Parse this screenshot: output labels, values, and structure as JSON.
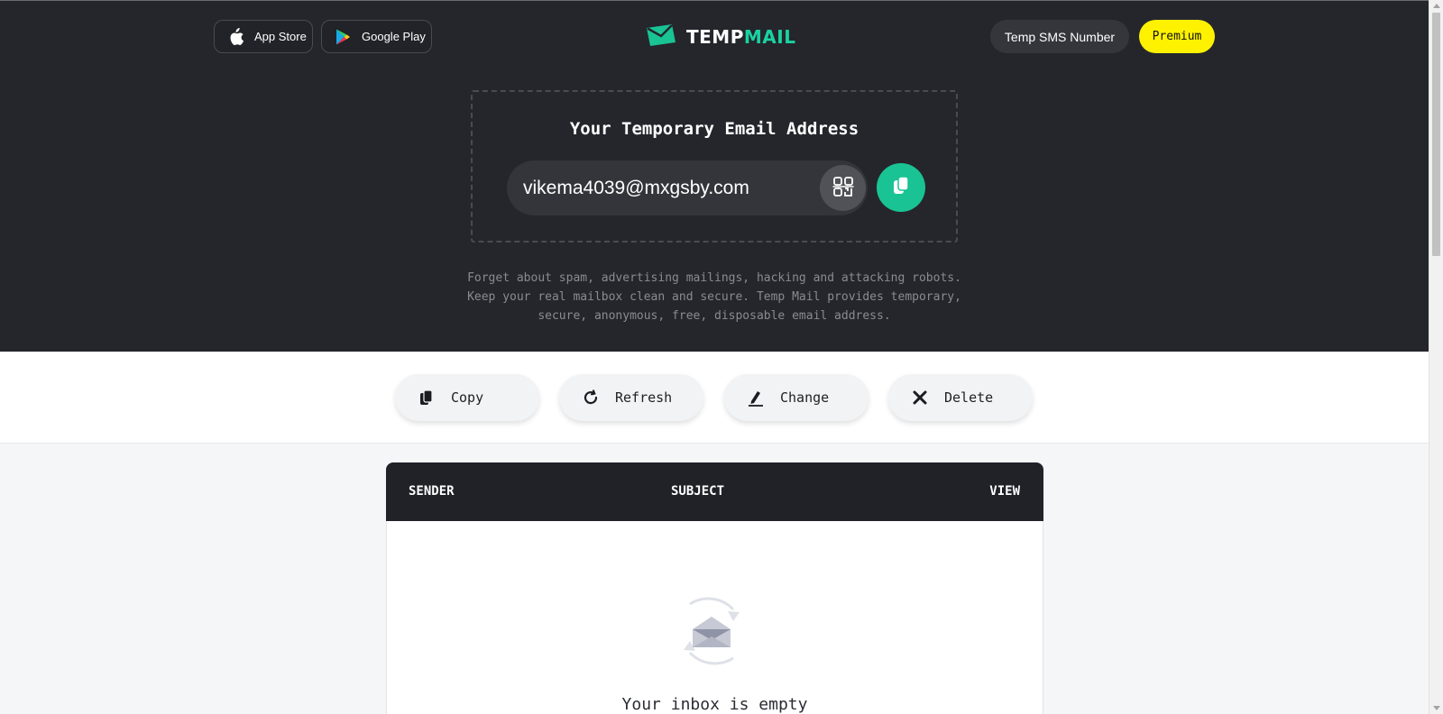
{
  "header": {
    "app_store_label": "App Store",
    "google_play_label": "Google Play",
    "logo_temp": "TEMP",
    "logo_mail": "MAIL",
    "temp_sms_label": "Temp SMS Number",
    "premium_label": "Premium"
  },
  "hero": {
    "title": "Your Temporary Email Address",
    "email": "vikema4039@mxgsby.com",
    "tagline": [
      "Forget about spam, advertising mailings, hacking and attacking robots.",
      "Keep your real mailbox clean and secure. Temp Mail provides temporary,",
      "secure, anonymous, free, disposable email address."
    ]
  },
  "actions": {
    "copy": "Copy",
    "refresh": "Refresh",
    "change": "Change",
    "delete": "Delete"
  },
  "inbox": {
    "columns": {
      "sender": "SENDER",
      "subject": "SUBJECT",
      "view": "VIEW"
    },
    "empty_text": "Your inbox is empty"
  },
  "colors": {
    "hero_bg": "#25262c",
    "accent_green": "#19c394",
    "premium_yellow": "#fef200"
  },
  "icons": {
    "app_store": "apple-icon",
    "google_play": "play-store-icon",
    "logo": "envelope-logo-icon",
    "qr": "qr-code-icon",
    "copy": "copy-icon",
    "refresh": "refresh-icon",
    "change": "edit-icon",
    "delete": "close-icon",
    "empty": "empty-inbox-icon"
  }
}
